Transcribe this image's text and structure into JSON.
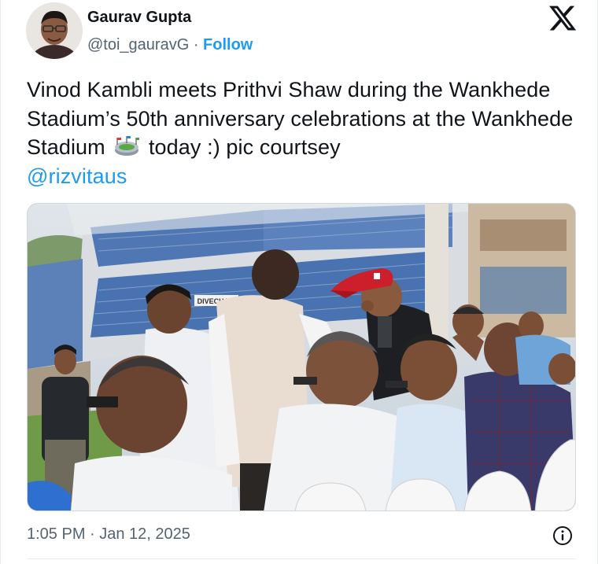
{
  "author": {
    "display_name": "Gaurav Gupta",
    "handle": "@toi_gauravG",
    "separator": " · ",
    "follow_label": "Follow"
  },
  "brand": {
    "logo_icon": "x-logo-icon"
  },
  "tweet": {
    "text_part1": "Vinod Kambli meets Prithvi  Shaw during the Wankhede Stadium’s 50th anniversary celebrations at the Wankhede Stadium",
    "emoji_icon": "stadium-icon",
    "text_part2": " today :) pic courtsey",
    "mention": "@rizvitaus",
    "media_sign_text": "DIVECHA P"
  },
  "meta": {
    "timestamp": "1:05 PM · Jan 12, 2025",
    "info_icon": "info-icon"
  },
  "colors": {
    "text": "#0f1419",
    "secondary": "#536471",
    "link": "#1d9bf0",
    "border": "#cfd9de"
  }
}
